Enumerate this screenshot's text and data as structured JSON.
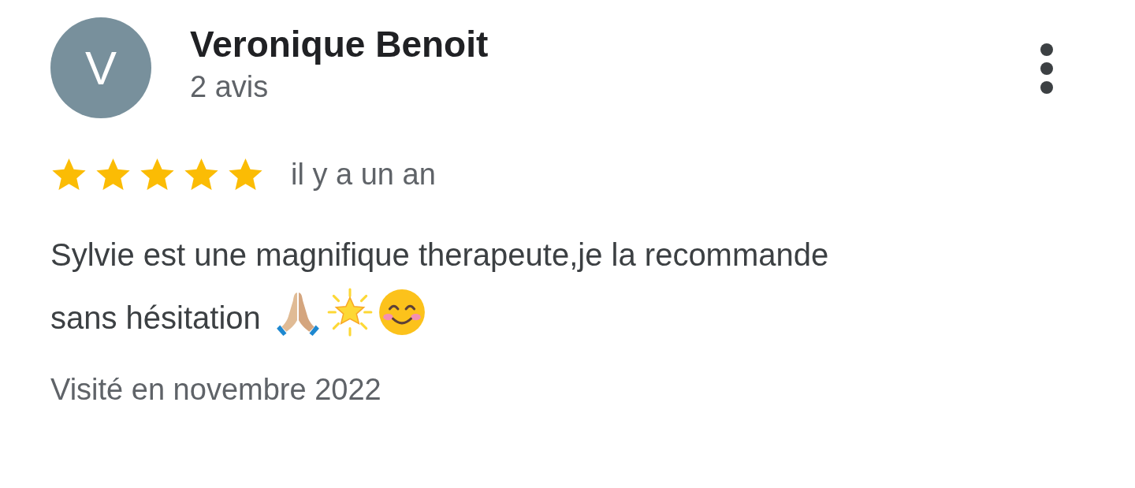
{
  "review": {
    "author": {
      "initial": "V",
      "name": "Veronique Benoit",
      "count": "2 avis"
    },
    "stars": 5,
    "time": "il y a un an",
    "text": "Sylvie est une magnifique therapeute,je la recommande sans hésitation",
    "visited": "Visité en novembre 2022"
  }
}
